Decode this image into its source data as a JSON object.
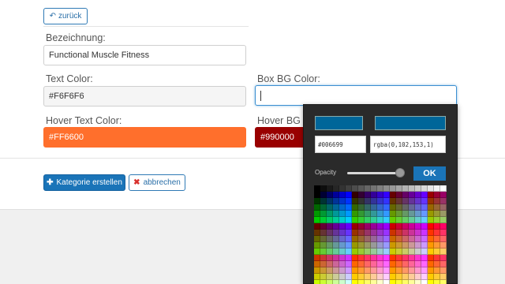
{
  "back_button": {
    "label": "zurück",
    "icon": "back-arrow-icon"
  },
  "fields": {
    "bezeichnung": {
      "label": "Bezeichnung:",
      "value": "Functional Muscle Fitness"
    },
    "text_color": {
      "label": "Text Color:",
      "value": "#F6F6F6"
    },
    "box_bg_color": {
      "label": "Box BG Color:",
      "value": ""
    },
    "hover_text_color": {
      "label": "Hover Text Color:",
      "value": "#FF6600",
      "swatch": "#ff6f2c"
    },
    "hover_bg_color": {
      "label": "Hover BG C",
      "value": "#990000",
      "swatch": "#990000"
    }
  },
  "actions": {
    "create_label": "Kategorie erstellen",
    "create_icon": "plus-icon",
    "cancel_label": "abbrechen",
    "cancel_icon": "x-icon"
  },
  "color_picker": {
    "selected_color": "#006699",
    "hex_value": "#006699",
    "rgba_value": "rgba(0,102,153,1)",
    "opacity_label": "Opacity",
    "opacity": 1,
    "ok_label": "OK"
  },
  "colors": {
    "primary": "#1a74b8",
    "orange": "#ff6f2c",
    "dark_red": "#990000",
    "picker_bg": "#2a2a2a"
  }
}
